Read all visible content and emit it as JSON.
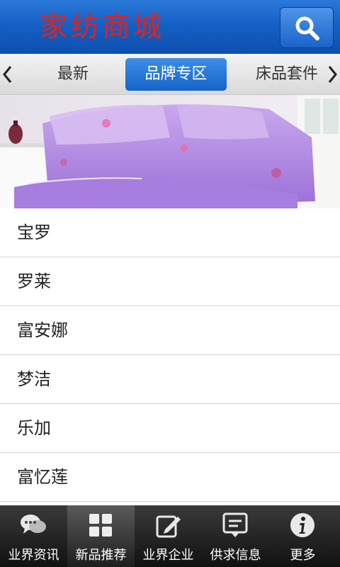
{
  "header": {
    "title": "家纺商城"
  },
  "tabs": [
    {
      "label": "最新"
    },
    {
      "label": "品牌专区"
    },
    {
      "label": "床品套件"
    }
  ],
  "brands": [
    "宝罗",
    "罗莱",
    "富安娜",
    "梦洁",
    "乐加",
    "富忆莲"
  ],
  "bottom_nav": [
    {
      "label": "业界资讯",
      "icon": "chat-bubbles-icon"
    },
    {
      "label": "新品推荐",
      "icon": "grid-icon"
    },
    {
      "label": "业界企业",
      "icon": "edit-icon"
    },
    {
      "label": "供求信息",
      "icon": "message-icon"
    },
    {
      "label": "更多",
      "icon": "info-icon"
    }
  ],
  "colors": {
    "header_blue": "#1560c6",
    "title_red": "#e0231c",
    "active_tab_blue": "#1563c8"
  }
}
